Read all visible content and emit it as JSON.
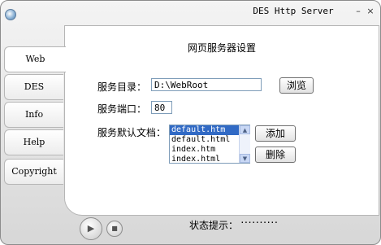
{
  "window": {
    "title": "DES Http Server",
    "minimize_glyph": "–",
    "close_glyph": "×"
  },
  "sidebar": {
    "tabs": [
      {
        "label": "Web",
        "active": true
      },
      {
        "label": "DES",
        "active": false
      },
      {
        "label": "Info",
        "active": false
      },
      {
        "label": "Help",
        "active": false
      },
      {
        "label": "Copyright",
        "active": false
      }
    ]
  },
  "panel": {
    "heading": "网页服务器设置",
    "root_dir": {
      "label": "服务目录：",
      "value": "D:\\WebRoot",
      "browse_label": "浏览"
    },
    "port": {
      "label": "服务端口：",
      "value": "80"
    },
    "default_docs": {
      "label": "服务默认文档：",
      "items": [
        "default.htm",
        "default.html",
        "index.htm",
        "index.html"
      ],
      "selected_index": 0,
      "add_label": "添加",
      "delete_label": "删除"
    }
  },
  "statusbar": {
    "label": "状态提示：",
    "value": "··········"
  },
  "icons": {
    "app": "app-icon",
    "play": "play-icon",
    "stop": "stop-icon",
    "scroll_up": "scroll-up-arrow-icon",
    "scroll_down": "scroll-down-arrow-icon"
  },
  "colors": {
    "selection": "#316ac5",
    "field_border": "#7f9db9",
    "window_bg": "#d7d7d7"
  }
}
